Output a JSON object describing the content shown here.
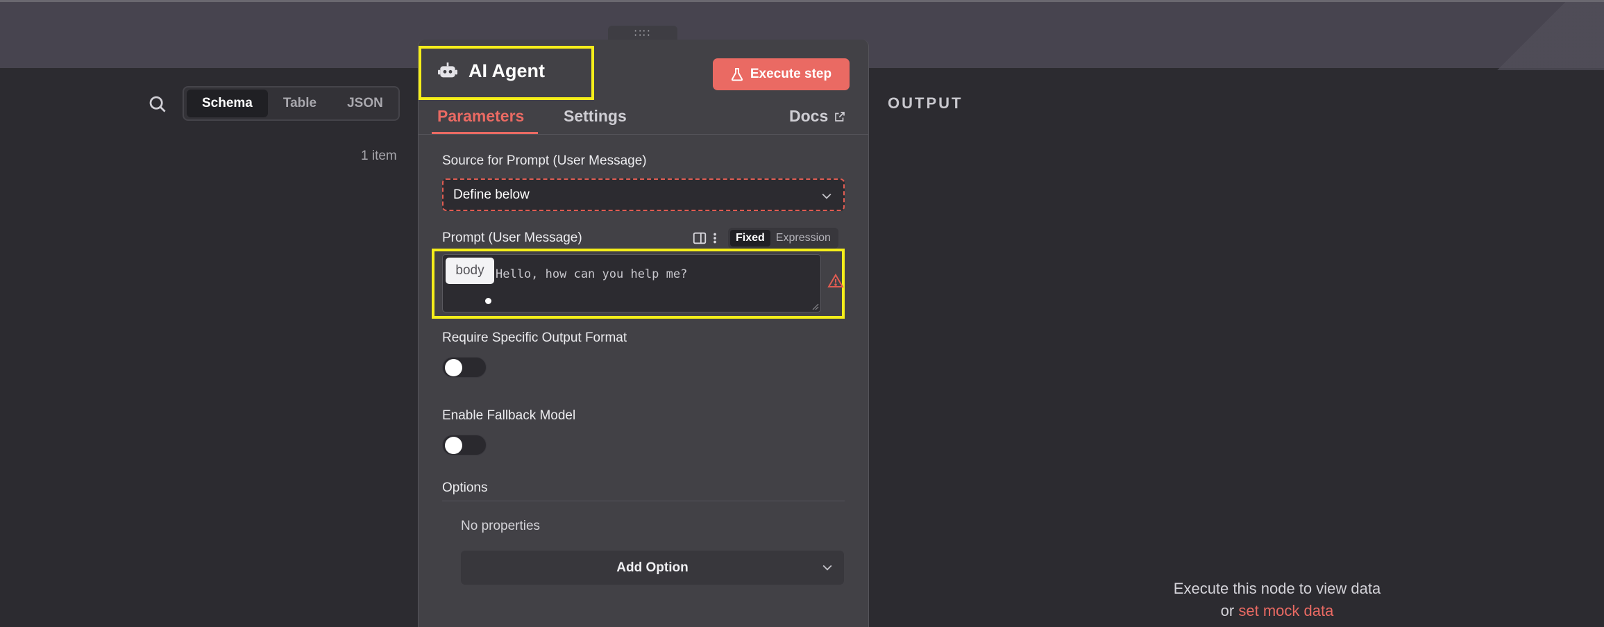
{
  "input_pane": {
    "view_tabs": [
      "Schema",
      "Table",
      "JSON"
    ],
    "active_view_tab": "Schema",
    "item_count": "1 item"
  },
  "panel": {
    "drag_handle": "∷∷",
    "title": "AI Agent",
    "title_icon": "robot-icon",
    "execute_button": "Execute step",
    "execute_icon": "flask-icon",
    "tabs": {
      "parameters": "Parameters",
      "settings": "Settings",
      "docs": "Docs"
    },
    "source_field": {
      "label": "Source for Prompt (User Message)",
      "value": "Define below"
    },
    "prompt_field": {
      "label": "Prompt (User Message)",
      "mode_fixed": "Fixed",
      "mode_expression": "Expression",
      "value": "Hello, how can you help me?",
      "tooltip_chip": "body"
    },
    "output_format": {
      "label": "Require Specific Output Format",
      "enabled": false
    },
    "fallback_model": {
      "label": "Enable Fallback Model",
      "enabled": false
    },
    "options": {
      "label": "Options",
      "empty_text": "No properties",
      "add_button": "Add Option"
    }
  },
  "output_pane": {
    "label": "OUTPUT",
    "hint_line1": "Execute this node to view data",
    "hint_or": "or",
    "hint_link": "set mock data"
  },
  "colors": {
    "accent": "#ea6a63",
    "highlight": "#f5ee1a",
    "panel_bg": "#424146",
    "canvas_bg": "#2c2b30"
  }
}
